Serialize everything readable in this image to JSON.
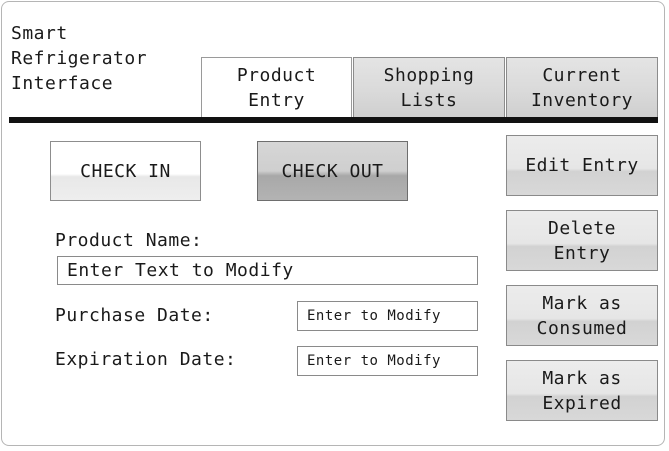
{
  "app": {
    "title": "Smart\nRefrigerator\nInterface"
  },
  "tabs": [
    {
      "label": "Product\nEntry",
      "active": true
    },
    {
      "label": "Shopping\nLists",
      "active": false
    },
    {
      "label": "Current\nInventory",
      "active": false
    }
  ],
  "actions": {
    "check_in": "CHECK IN",
    "check_out": "CHECK OUT"
  },
  "form": {
    "product_name_label": "Product Name:",
    "product_name_value": "Enter Text to Modify",
    "purchase_date_label": "Purchase Date:",
    "purchase_date_value": "Enter to Modify",
    "expiration_date_label": "Expiration Date:",
    "expiration_date_value": "Enter to Modify"
  },
  "side_buttons": {
    "edit_entry": "Edit Entry",
    "delete_entry": "Delete\nEntry",
    "mark_consumed": "Mark as\nConsumed",
    "mark_expired": "Mark as\nExpired"
  },
  "colors": {
    "header_rule": "#111111",
    "border": "#8d8d8d",
    "check_out_fill": "#b3b3b3"
  }
}
